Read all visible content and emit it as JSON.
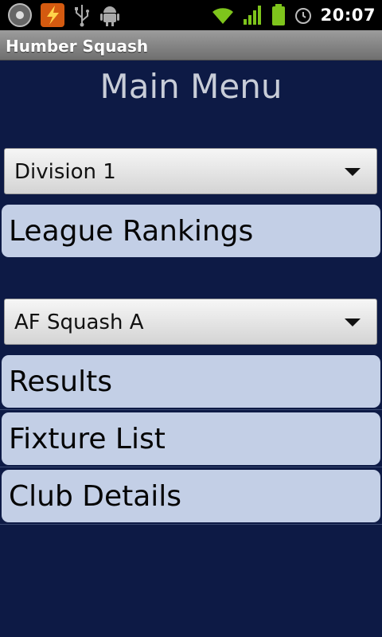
{
  "status_bar": {
    "time": "20:07",
    "icons": [
      "media-icon",
      "flash-icon",
      "usb-icon",
      "android-debug-icon",
      "wifi-icon",
      "signal-icon",
      "battery-icon",
      "alarm-icon"
    ]
  },
  "app": {
    "title": "Humber Squash"
  },
  "main": {
    "heading": "Main Menu",
    "division_select": {
      "selected": "Division 1"
    },
    "league_button": "League Rankings",
    "team_select": {
      "selected": "AF Squash A"
    },
    "buttons": [
      "Results",
      "Fixture List",
      "Club Details"
    ]
  },
  "colors": {
    "background": "#0d1a45",
    "button": "#c3cfe6",
    "heading": "#c8cdd8"
  }
}
